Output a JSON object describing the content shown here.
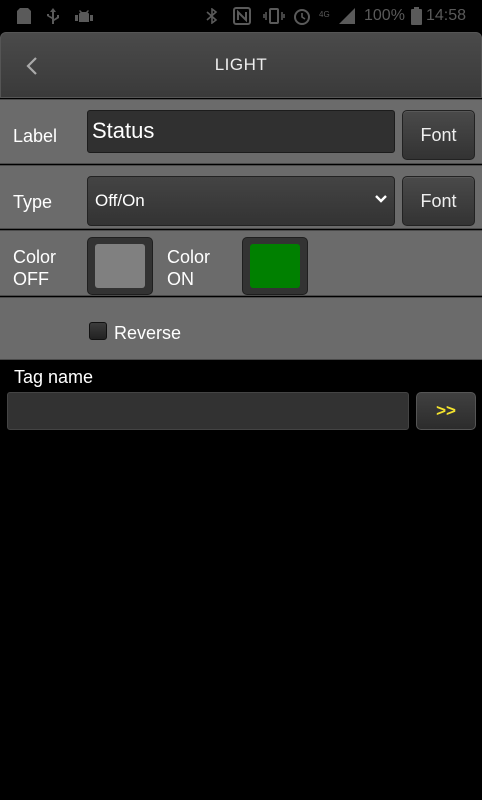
{
  "status_bar": {
    "battery_percent": "100%",
    "time": "14:58"
  },
  "header": {
    "title": "LIGHT"
  },
  "label_row": {
    "label": "Label",
    "value": "Status",
    "font_button": "Font"
  },
  "type_row": {
    "label": "Type",
    "selected": "Off/On",
    "font_button": "Font"
  },
  "color_row": {
    "off_label_line1": "Color",
    "off_label_line2": "OFF",
    "off_color": "#808080",
    "on_label_line1": "Color",
    "on_label_line2": "ON",
    "on_color": "#008000"
  },
  "reverse_row": {
    "label": "Reverse",
    "checked": false
  },
  "tag": {
    "label": "Tag name",
    "value": "",
    "browse_button": ">>"
  }
}
